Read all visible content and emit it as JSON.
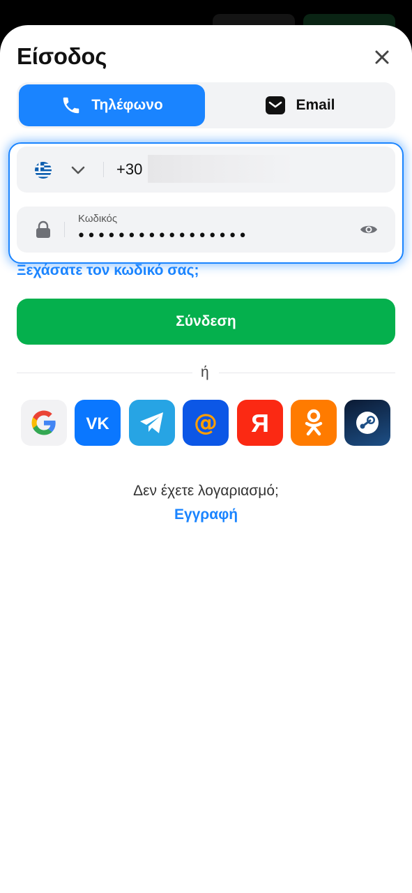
{
  "dialog": {
    "title": "Είσοδος"
  },
  "tabs": [
    {
      "label": "Τηλέφωνο",
      "icon": "phone-icon",
      "active": true
    },
    {
      "label": "Email",
      "icon": "email-icon",
      "active": false
    }
  ],
  "phone": {
    "country_flag": "greece-flag-icon",
    "country_code": "+30"
  },
  "password": {
    "label": "Κωδικός",
    "masked_value": "•••••••••••••••••"
  },
  "forgot_link": "Ξεχάσατε τον κωδικό σας;",
  "login_button": "Σύνδεση",
  "divider_text": "ή",
  "social_providers": [
    {
      "name": "google",
      "icon": "google-icon",
      "color": "#f2f2f4"
    },
    {
      "name": "vk",
      "icon": "vk-icon",
      "color": "#0a77ff"
    },
    {
      "name": "telegram",
      "icon": "telegram-icon",
      "color": "#27a4e4"
    },
    {
      "name": "mail.ru",
      "icon": "mail-at-icon",
      "color": "#0c57e6"
    },
    {
      "name": "yandex",
      "icon": "yandex-icon",
      "color": "#fb2913"
    },
    {
      "name": "odnoklassniki",
      "icon": "ok-icon",
      "color": "#ff7b00"
    },
    {
      "name": "steam",
      "icon": "steam-icon",
      "color": "#1d4f86"
    }
  ],
  "signup": {
    "prompt": "Δεν έχετε λογαριασμό;",
    "link": "Εγγραφή"
  },
  "colors": {
    "accent": "#1a84ff",
    "primary_button": "#05b04d",
    "field_bg": "#f2f3f5"
  }
}
